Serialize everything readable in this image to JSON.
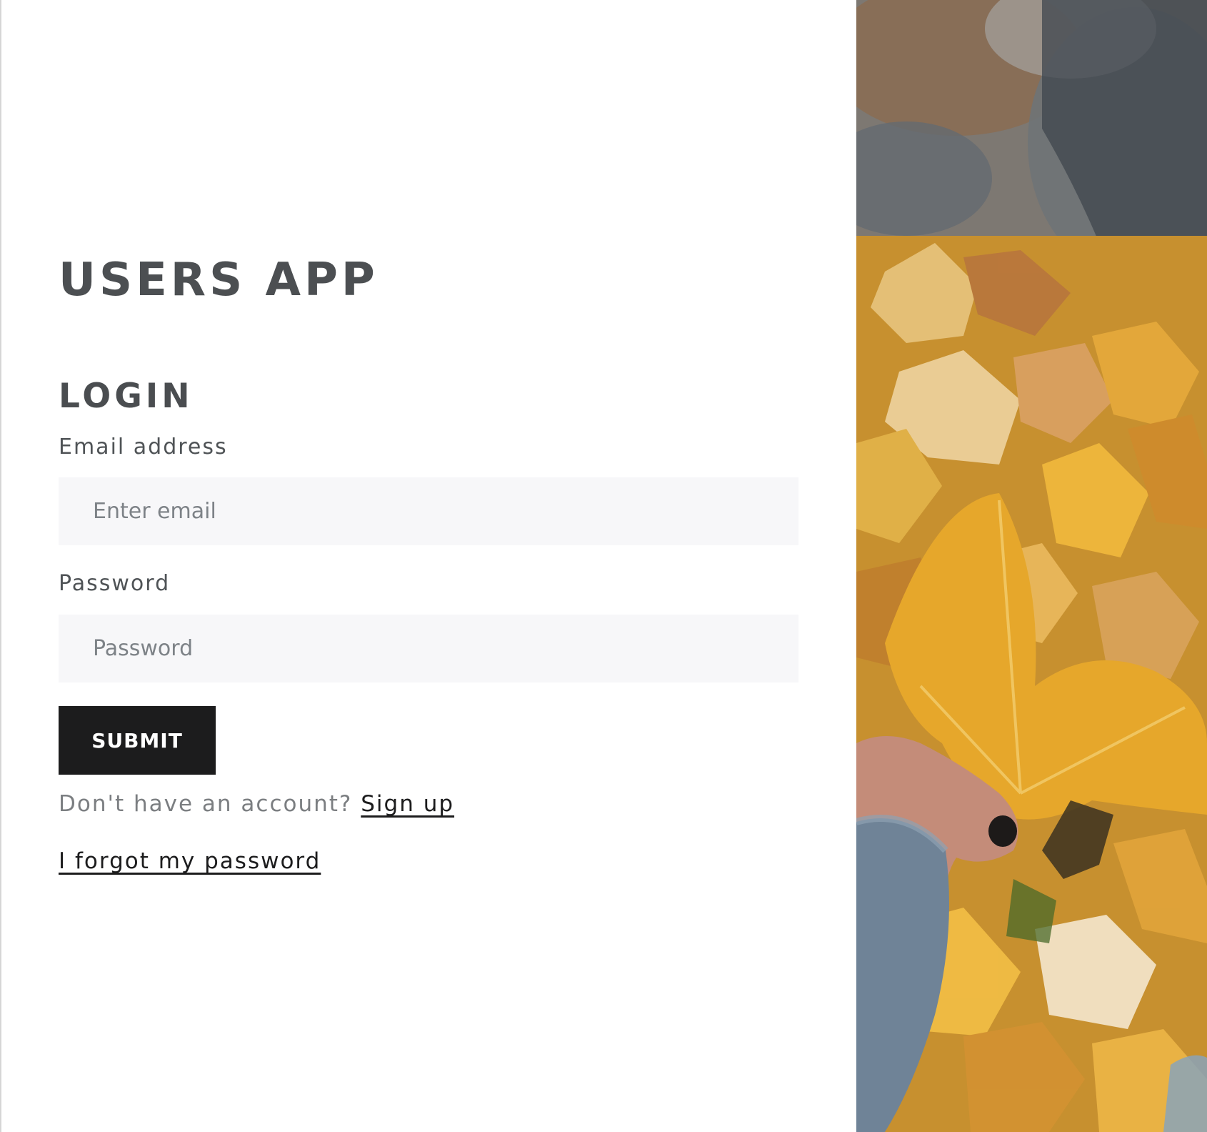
{
  "app": {
    "title": "USERS APP"
  },
  "login": {
    "heading": "LOGIN",
    "email": {
      "label": "Email address",
      "placeholder": "Enter email",
      "value": ""
    },
    "password": {
      "label": "Password",
      "placeholder": "Password",
      "value": ""
    },
    "submit_label": "SUBMIT",
    "signup_prompt": "Don't have an account?",
    "signup_link": "Sign up",
    "forgot_link": "I forgot my password"
  },
  "hero_image": {
    "icon": "autumn-leaves-photo"
  },
  "colors": {
    "title_text": "#4c4f52",
    "input_background": "#f7f7f9",
    "button_background": "#1c1c1d",
    "button_text": "#ffffff",
    "muted_text": "#7b7e81",
    "link_text": "#1c1c1d"
  }
}
